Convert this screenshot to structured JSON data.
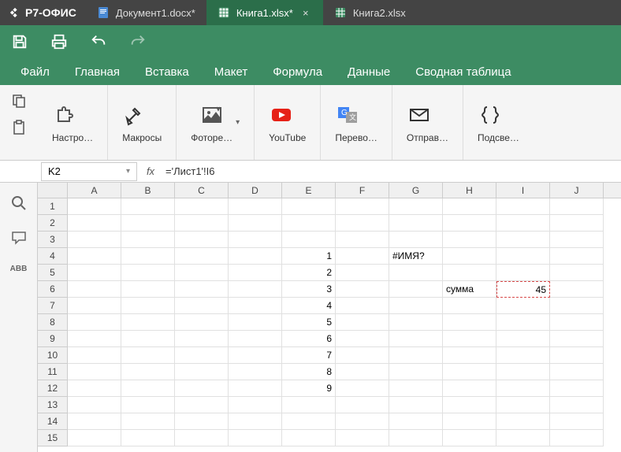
{
  "app_name": "Р7-ОФИС",
  "tabs": [
    {
      "label": "Документ1.docx*",
      "type": "doc",
      "active": false
    },
    {
      "label": "Книга1.xlsx*",
      "type": "sheet",
      "active": true
    },
    {
      "label": "Книга2.xlsx",
      "type": "sheet",
      "active": false
    }
  ],
  "menus": [
    "Файл",
    "Главная",
    "Вставка",
    "Макет",
    "Формула",
    "Данные",
    "Сводная таблица"
  ],
  "ribbon": [
    {
      "label": "Настро…",
      "icon": "puzzle"
    },
    {
      "label": "Макросы",
      "icon": "tools"
    },
    {
      "label": "Фоторе…",
      "icon": "photo",
      "arrow": true
    },
    {
      "label": "YouTube",
      "icon": "youtube"
    },
    {
      "label": "Перево…",
      "icon": "translate"
    },
    {
      "label": "Отправ…",
      "icon": "mail"
    },
    {
      "label": "Подсве…",
      "icon": "braces"
    }
  ],
  "name_box": "K2",
  "formula": "='Лист1'!I6",
  "columns": [
    "A",
    "B",
    "C",
    "D",
    "E",
    "F",
    "G",
    "H",
    "I",
    "J"
  ],
  "row_count": 15,
  "cells": {
    "E4": {
      "v": "1",
      "t": "num"
    },
    "E5": {
      "v": "2",
      "t": "num"
    },
    "E6": {
      "v": "3",
      "t": "num"
    },
    "E7": {
      "v": "4",
      "t": "num"
    },
    "E8": {
      "v": "5",
      "t": "num"
    },
    "E9": {
      "v": "6",
      "t": "num"
    },
    "E10": {
      "v": "7",
      "t": "num"
    },
    "E11": {
      "v": "8",
      "t": "num"
    },
    "E12": {
      "v": "9",
      "t": "num"
    },
    "G4": {
      "v": "#ИМЯ?",
      "t": "txt"
    },
    "H6": {
      "v": "сумма",
      "t": "txt"
    },
    "I6": {
      "v": "45",
      "t": "num",
      "sel": true
    }
  },
  "fx_label": "fx",
  "abc_label": "ABB"
}
